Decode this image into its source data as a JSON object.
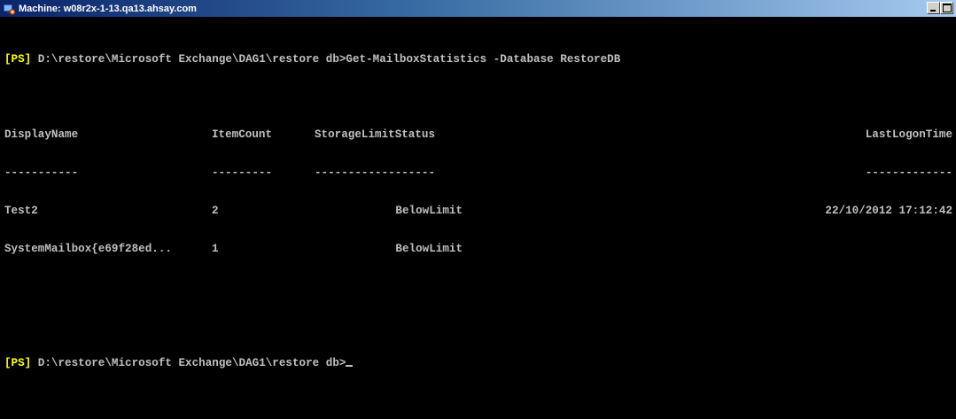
{
  "window": {
    "title": "Machine: w08r2x-1-13.qa13.ahsay.com"
  },
  "console": {
    "prompt_tag": "[PS]",
    "command_line": " D:\\restore\\Microsoft Exchange\\DAG1\\restore db>Get-MailboxStatistics -Database RestoreDB",
    "headers": {
      "display_name": "DisplayName",
      "item_count": "ItemCount",
      "storage_limit_status": "StorageLimitStatus",
      "last_logon_time": "LastLogonTime"
    },
    "underlines": {
      "display_name": "-----------",
      "item_count": "---------",
      "storage_limit_status": "------------------",
      "last_logon_time": "-------------"
    },
    "rows": [
      {
        "display_name": "Test2",
        "item_count": "2",
        "storage_limit_status": "BelowLimit",
        "last_logon_time": "22/10/2012 17:12:42"
      },
      {
        "display_name": "SystemMailbox{e69f28ed...",
        "item_count": "1",
        "storage_limit_status": "BelowLimit",
        "last_logon_time": ""
      }
    ],
    "final_prompt": " D:\\restore\\Microsoft Exchange\\DAG1\\restore db>"
  },
  "colors": {
    "background": "#000000",
    "text": "#c0c0c0",
    "prompt_tag": "#ffff00",
    "titlebar_start": "#0a246a",
    "titlebar_end": "#a6caf0"
  },
  "icons": {
    "app": "powershell-remote-icon",
    "minimize": "minimize-icon",
    "maximize": "maximize-icon"
  }
}
